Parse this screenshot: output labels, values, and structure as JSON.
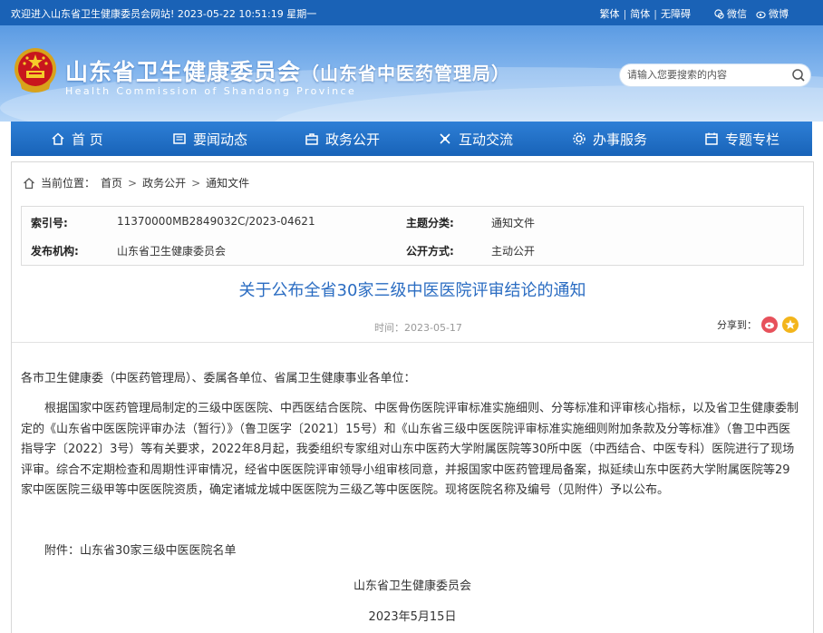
{
  "topbar": {
    "welcome": "欢迎进入山东省卫生健康委员会网站! 2023-05-22 10:51:19 星期一",
    "links": [
      "繁体",
      "简体",
      "无障碍"
    ],
    "separator": "|",
    "social": [
      "微信",
      "微博"
    ]
  },
  "header": {
    "title": "山东省卫生健康委员会",
    "subtitle": "（山东省中医药管理局）",
    "title_en": "Health Commission of Shandong Province"
  },
  "search": {
    "placeholder": "请输入您要搜索的内容"
  },
  "nav": {
    "items": [
      "首 页",
      "要闻动态",
      "政务公开",
      "互动交流",
      "办事服务",
      "专题专栏"
    ]
  },
  "breadcrumb": {
    "label": "当前位置：",
    "items": [
      "首页",
      "政务公开",
      "通知文件"
    ],
    "separator": ">"
  },
  "meta": {
    "index_label": "索引号:",
    "index_value": "11370000MB2849032C/2023-04621",
    "topic_label": "主题分类:",
    "topic_value": "通知文件",
    "publisher_label": "发布机构:",
    "publisher_value": "山东省卫生健康委员会",
    "disclosure_label": "公开方式:",
    "disclosure_value": "主动公开"
  },
  "article": {
    "title": "关于公布全省30家三级中医医院评审结论的通知",
    "time": "时间：2023-05-17",
    "share_label": "分享到：",
    "salutation": "各市卫生健康委（中医药管理局）、委属各单位、省属卫生健康事业各单位：",
    "paragraph": "根据国家中医药管理局制定的三级中医医院、中西医结合医院、中医骨伤医院评审标准实施细则、分等标准和评审核心指标，以及省卫生健康委制定的《山东省中医医院评审办法（暂行）》（鲁卫医字〔2021〕15号）和《山东省三级中医医院评审标准实施细则附加条款及分等标准》（鲁卫中西医指导字〔2022〕3号）等有关要求，2022年8月起，我委组织专家组对山东中医药大学附属医院等30所中医（中西结合、中医专科）医院进行了现场评审。综合不定期检查和周期性评审情况，经省中医医院评审领导小组审核同意，并报国家中医药管理局备案，拟延续山东中医药大学附属医院等29家中医医院三级甲等中医医院资质，确定诸城龙城中医医院为三级乙等中医医院。现将医院名称及编号（见附件）予以公布。",
    "attachment": "附件：山东省30家三级中医医院名单",
    "signature": "山东省卫生健康委员会",
    "date": "2023年5月15日"
  },
  "colors": {
    "topbar": "#1a62b6",
    "nav": "#1f6cc2",
    "title": "#2a6cc2"
  }
}
